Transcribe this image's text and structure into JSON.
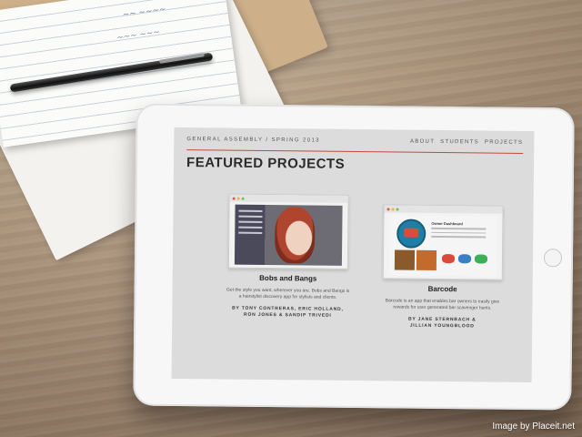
{
  "screen": {
    "brand": "GENERAL ASSEMBLY / SPRING 2013",
    "nav": [
      "ABOUT",
      "STUDENTS",
      "PROJECTS"
    ],
    "title": "FEATURED PROJECTS",
    "projects": [
      {
        "title": "Bobs and Bangs",
        "description": "Get the style you want, wherever you are. Bobs and Bangs is a hairstylist discovery app for stylists and clients.",
        "byline_1": "BY TONY CONTRERAS, ERIC HOLLAND,",
        "byline_2": "RON JONES & SANDIP TRIVEDI"
      },
      {
        "title": "Barcode",
        "description": "Barcode is an app that enables bar owners to easily give rewards for user generated bar scavenger hunts.",
        "byline_1": "BY JANE STERNBACH &",
        "byline_2": "JILLIAN YOUNGBLOOD",
        "screenshot_header": "Owner Dashboard"
      }
    ]
  },
  "credit": "Image by Placeit.net",
  "colors": {
    "accent_line": "#c44a3b",
    "wood": "#b79c80"
  }
}
